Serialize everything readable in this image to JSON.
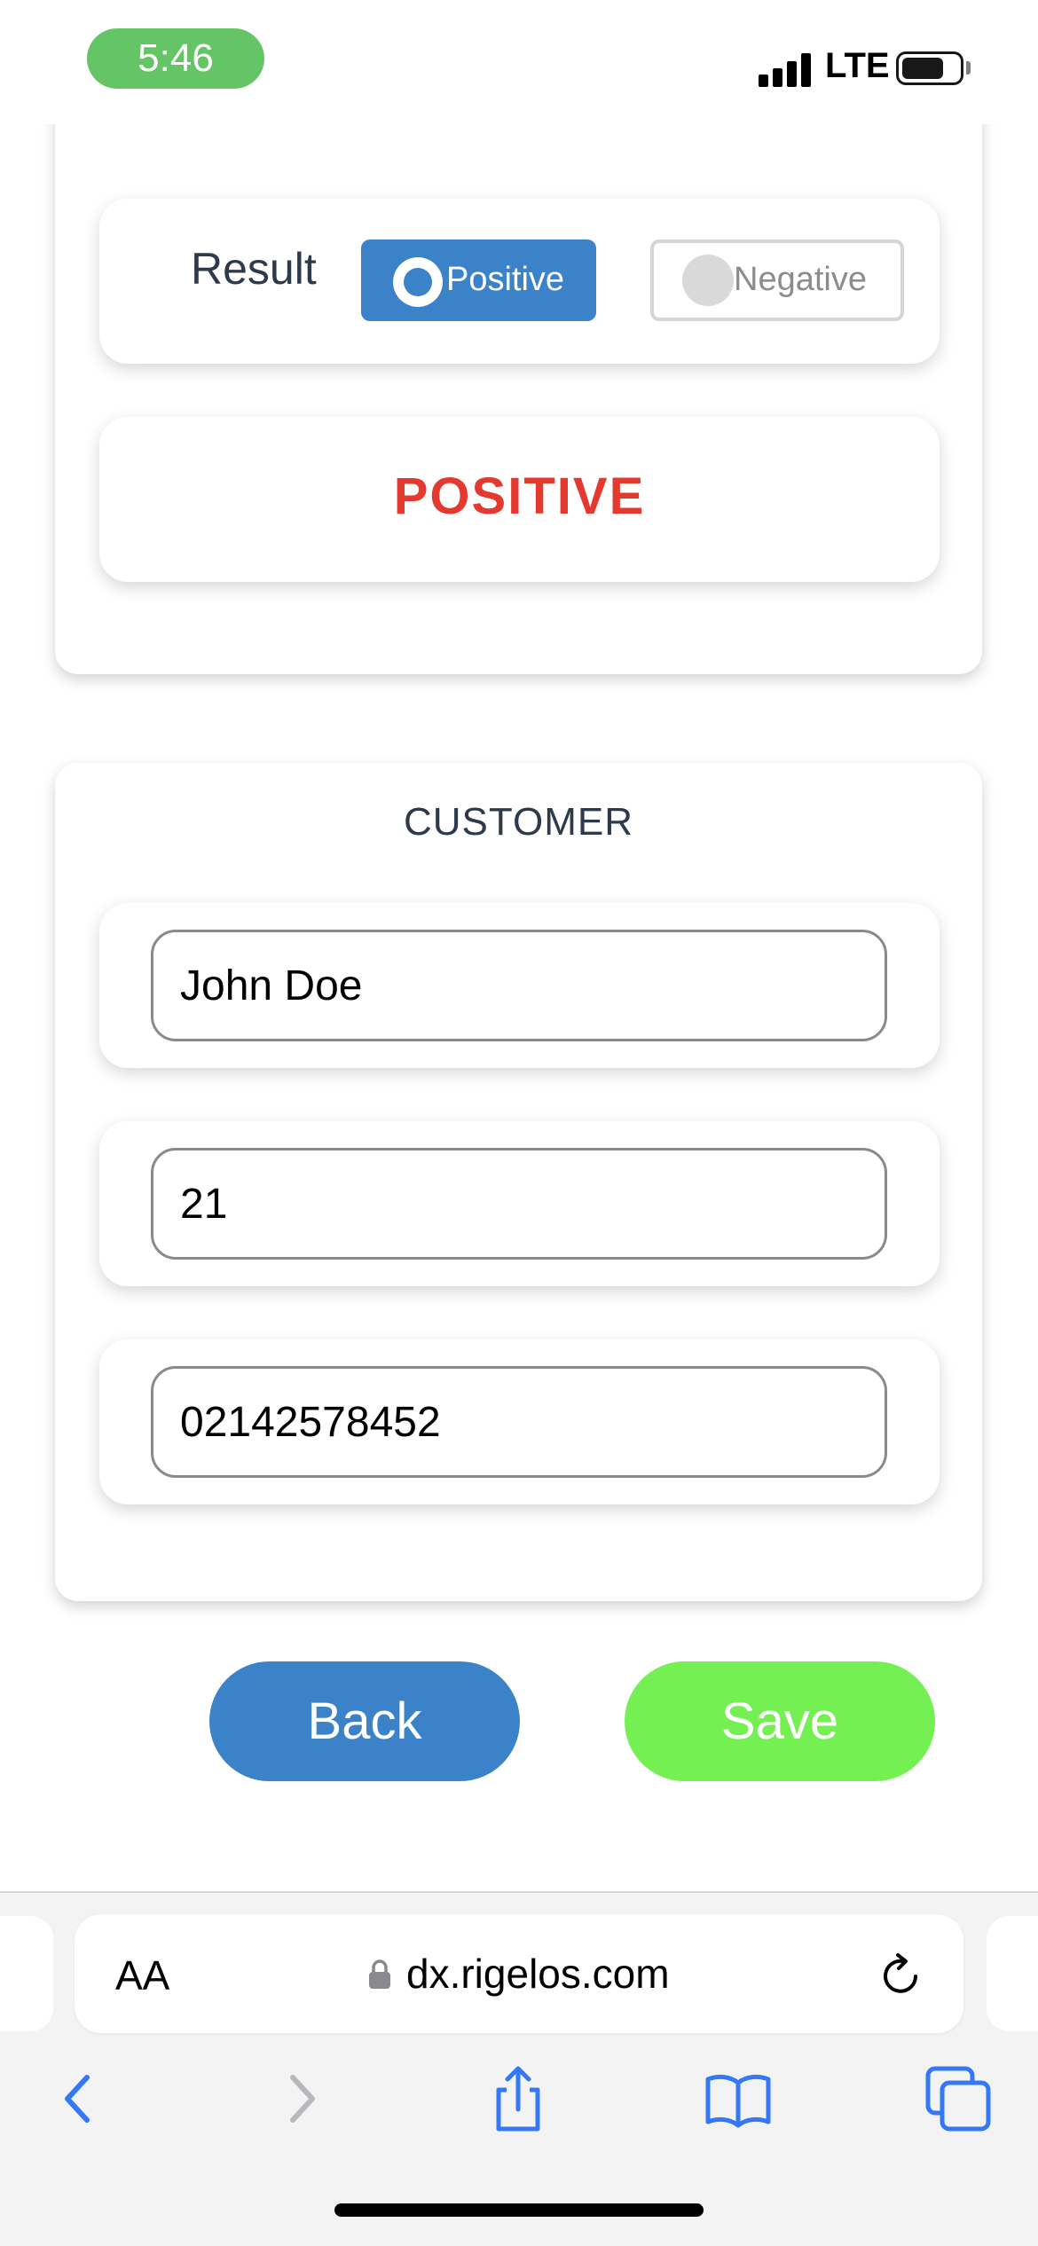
{
  "status_bar": {
    "time": "5:46",
    "network": "LTE",
    "colors": {
      "time_pill": "#65c466"
    }
  },
  "result_card": {
    "label": "Result",
    "options": [
      {
        "label": "Positive",
        "selected": true
      },
      {
        "label": "Negative",
        "selected": false
      }
    ],
    "value": "POSITIVE",
    "colors": {
      "selected": "#3b82c9",
      "value_text": "#e3392e"
    }
  },
  "customer": {
    "title": "CUSTOMER",
    "name_value": "John Doe",
    "age_value": "21",
    "phone_value": "02142578452"
  },
  "actions": {
    "back_label": "Back",
    "save_label": "Save",
    "colors": {
      "back": "#3b82c9",
      "save": "#74f052"
    }
  },
  "browser": {
    "text_size_label": "AA",
    "url": "dx.rigelos.com",
    "icons": [
      "lock-icon",
      "reload-icon",
      "back-arrow-icon",
      "forward-arrow-icon",
      "share-icon",
      "bookmarks-icon",
      "tabs-icon"
    ]
  }
}
